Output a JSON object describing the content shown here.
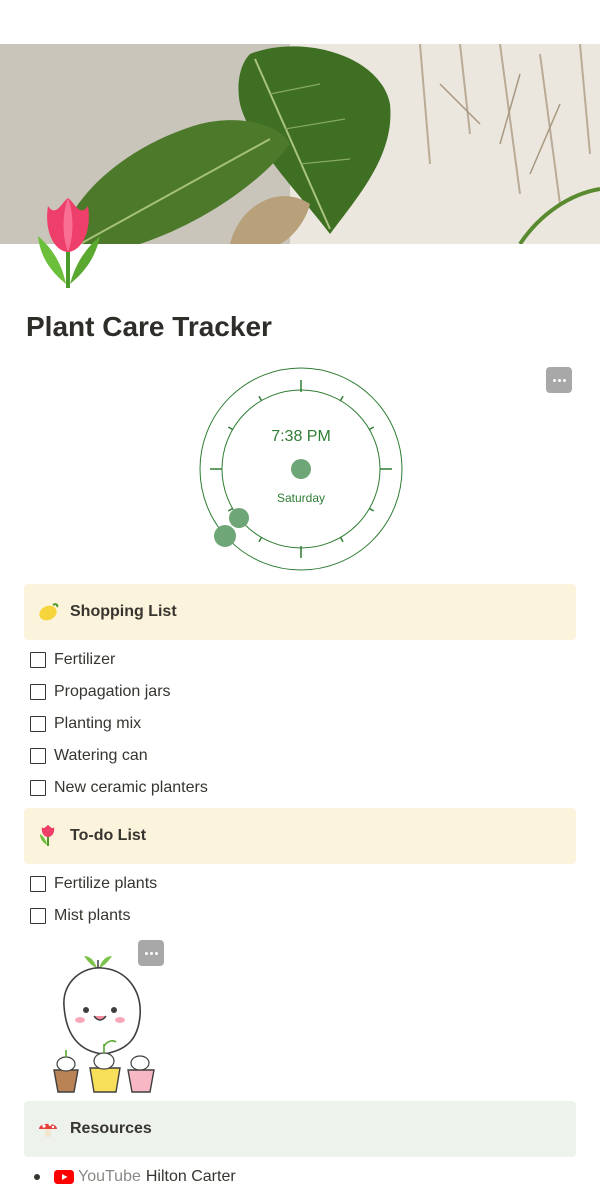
{
  "page": {
    "title": "Plant Care Tracker",
    "icon": "tulip-icon",
    "cover": "monstera-leaves-cover"
  },
  "clock": {
    "time": "7:38 PM",
    "day": "Saturday",
    "accent_color": "#2e7d32",
    "hand_color": "#6fa677"
  },
  "shopping": {
    "heading": "Shopping List",
    "icon": "lemon-icon",
    "background": "#fbf3db",
    "items": [
      "Fertilizer",
      "Propagation jars",
      "Planting mix",
      "Watering can",
      "New ceramic planters"
    ]
  },
  "todo": {
    "heading": "To-do List",
    "icon": "tulip-icon",
    "background": "#fbf3db",
    "items": [
      "Fertilize plants",
      "Mist plants"
    ]
  },
  "resources": {
    "heading": "Resources",
    "icon": "mushroom-icon",
    "background": "#edf3ec",
    "links": [
      {
        "source": "YouTube",
        "title": "Hilton Carter",
        "icon": "youtube-icon"
      }
    ]
  }
}
